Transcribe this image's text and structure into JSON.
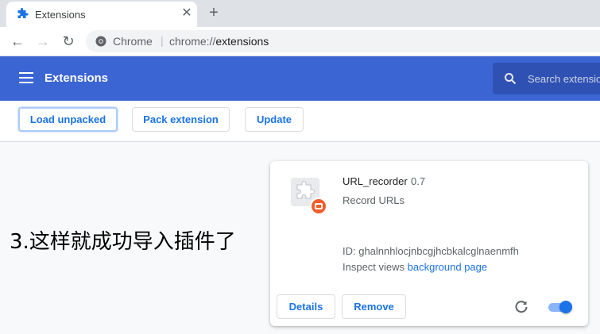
{
  "tab": {
    "title": "Extensions",
    "close_glyph": "✕",
    "new_tab_glyph": "+"
  },
  "toolbar": {
    "back_glyph": "←",
    "forward_glyph": "→",
    "reload_glyph": "↻",
    "site_label": "Chrome",
    "separator": "|",
    "url_scheme": "chrome://",
    "url_host": "extensions"
  },
  "header": {
    "title": "Extensions",
    "search_placeholder": "Search extensions"
  },
  "dev_toolbar": {
    "load_unpacked": "Load unpacked",
    "pack_extension": "Pack extension",
    "update": "Update"
  },
  "caption": "3.这样就成功导入插件了",
  "extension": {
    "name": "URL_recorder",
    "version": "0.7",
    "description": "Record URLs",
    "id_line": "ID: ghalnnhlocjnbcgjhcbkalcglnaenmfh",
    "inspect_label": "Inspect views ",
    "inspect_link": "background page",
    "details_label": "Details",
    "remove_label": "Remove",
    "enabled": true
  },
  "colors": {
    "header": "#3c65d4",
    "accent": "#1a73e8",
    "badge": "#f25c2a"
  }
}
